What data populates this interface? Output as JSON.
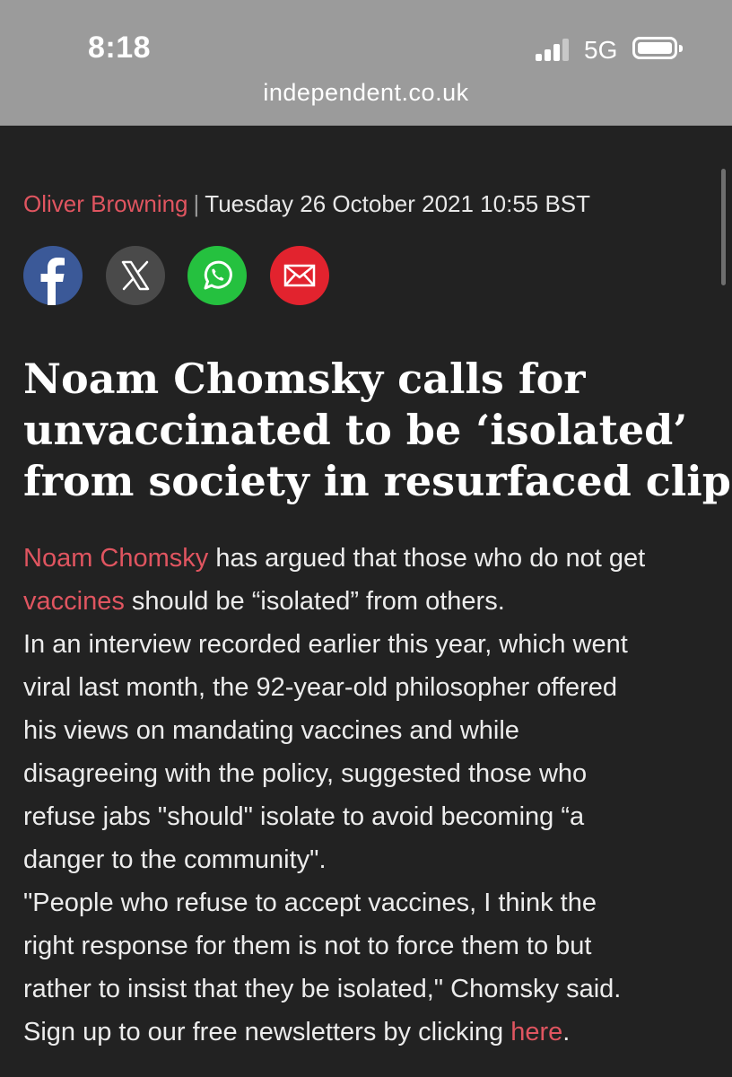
{
  "status_bar": {
    "time": "8:18",
    "network": "5G",
    "signal_bars": 3,
    "battery_icon": "battery-full-icon"
  },
  "browser": {
    "url": "independent.co.uk"
  },
  "article": {
    "author": "Oliver Browning",
    "separator": "|",
    "date": "Tuesday 26 October 2021 10:55 BST",
    "share_icons": [
      "facebook-icon",
      "x-icon",
      "whatsapp-icon",
      "email-icon"
    ],
    "headline_lines": [
      "Noam Chomsky calls for",
      "unvaccinated to be ‘isolated’",
      "from society in resurfaced clip"
    ],
    "para1": {
      "link1": "Noam Chomsky",
      "line1_rest": " has argued that those who do not get",
      "link2": "vaccines",
      "line2_rest": " should be “isolated” from others."
    },
    "para2_lines": [
      "In an interview recorded earlier this year, which went",
      "viral last month, the 92-year-old philosopher offered",
      "his views on mandating vaccines and while",
      "disagreeing with the policy, suggested those who",
      "refuse jabs \"should\" isolate to avoid becoming “a",
      "danger to the community\"."
    ],
    "para3_lines": [
      "\"People who refuse to accept vaccines, I think the",
      "right response for them is not to force them to but",
      "rather to insist that they be isolated,\" Chomsky said."
    ],
    "para4": {
      "text": "Sign up to our free newsletters by clicking ",
      "link": "here",
      "end": "."
    }
  },
  "colors": {
    "background": "#222222",
    "topbar": "#9b9b9b",
    "accent": "#e05560",
    "facebook": "#3b5998",
    "x": "#4a4a4a",
    "whatsapp": "#25c13f",
    "email": "#e2232e"
  }
}
